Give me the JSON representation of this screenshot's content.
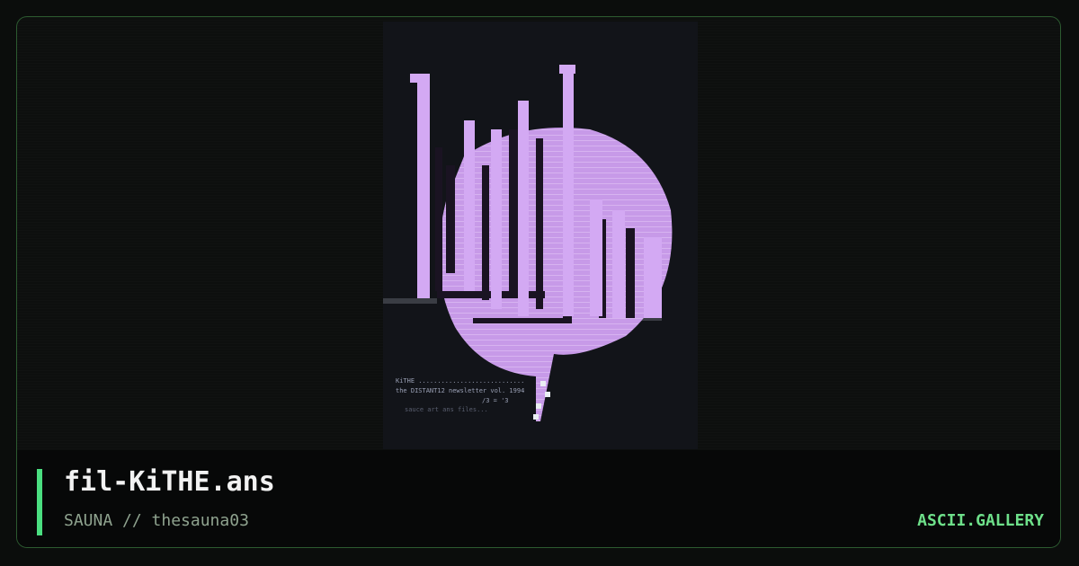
{
  "artwork": {
    "logo_text": "KiTHE",
    "info_lines": [
      "KiTHE ............................",
      "the DISTANT12 newsletter vol. 1994",
      "/3 = '3"
    ],
    "footer_line": "sauce art ans files..."
  },
  "footer": {
    "title": "fil-KiTHE.ans",
    "subtitle": "SAUNA // thesauna03",
    "brand": "ASCII.GALLERY"
  },
  "colors": {
    "accent": "#4ade80",
    "frame_border": "#2c5a30",
    "art_purple": "#c79ae8",
    "art_dark": "#121419"
  }
}
